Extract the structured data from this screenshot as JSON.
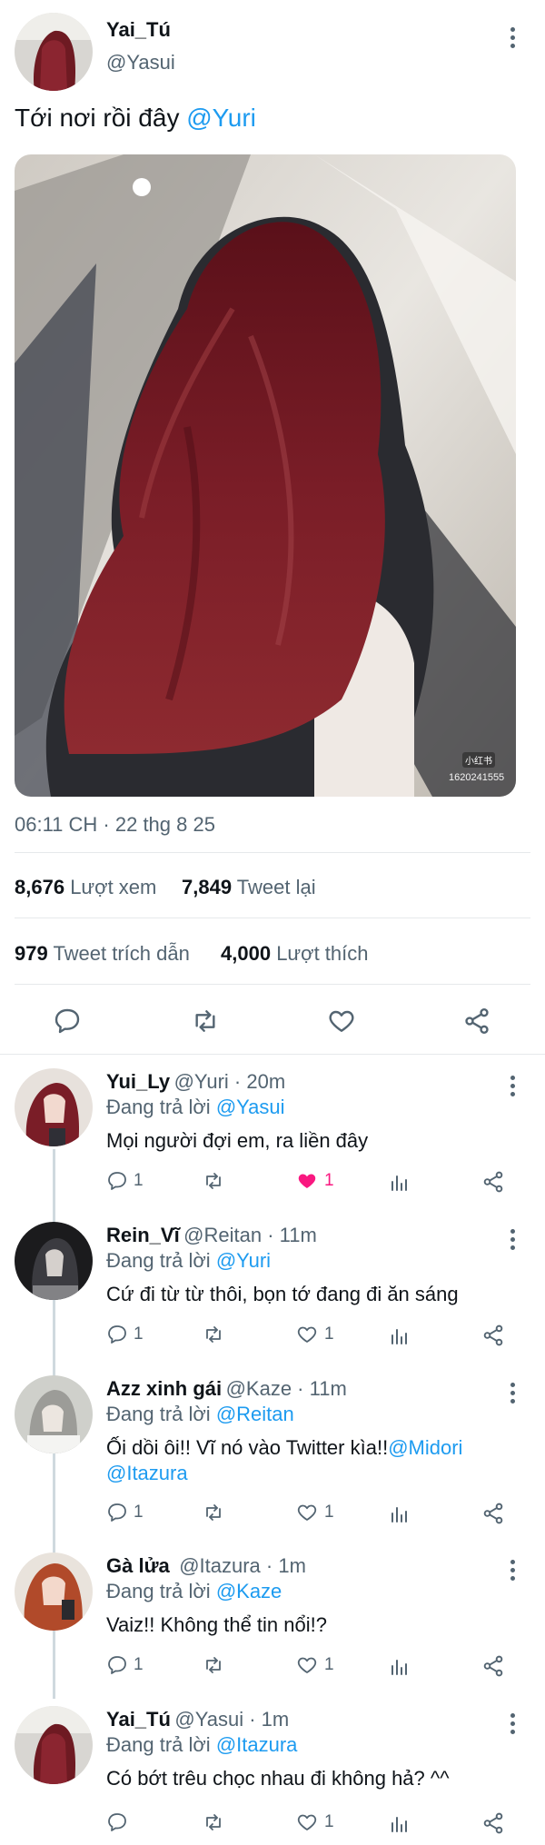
{
  "tweet": {
    "author_name": "Yai_Tú",
    "author_handle": "@Yasui",
    "text": "Tới nơi rồi đây ",
    "mention": "@Yuri",
    "watermark_logo": "小红书",
    "watermark_id": "1620241555",
    "timestamp": "06:11 CH · 22 thg 8 25",
    "views_count": "8,676",
    "views_label": "Lượt xem",
    "retweets_count": "7,849",
    "retweets_label": "Tweet lại",
    "quotes_count": "979",
    "quotes_label": "Tweet trích dẫn",
    "likes_count": "4,000",
    "likes_label": "Lượt thích"
  },
  "replies": [
    {
      "name": "Yui_Ly",
      "meta": "@Yuri · 20m",
      "replying_prefix": "Đang trả lời ",
      "replying_to": "@Yasui",
      "text": "Mọi người đợi em, ra liền đây",
      "text_link": "",
      "text_line2": "",
      "reply_count": "1",
      "like_count": "1",
      "liked": true
    },
    {
      "name": "Rein_Vĩ",
      "meta": "@Reitan · 11m",
      "replying_prefix": "Đang trả lời ",
      "replying_to": "@Yuri",
      "text": "Cứ đi từ từ thôi, bọn tớ đang đi ăn sáng",
      "text_link": "",
      "text_line2": "",
      "reply_count": "1",
      "like_count": "1",
      "liked": false
    },
    {
      "name": "Azz xinh gái",
      "meta": "@Kaze · 11m",
      "replying_prefix": "Đang trả lời ",
      "replying_to": "@Reitan",
      "text": "Ối dồi ôi!! Vĩ nó vào Twitter kìa!!",
      "text_link": "@Midori",
      "text_line2": "@Itazura",
      "reply_count": "1",
      "like_count": "1",
      "liked": false
    },
    {
      "name": "Gà lửa",
      "meta": "@Itazura · 1m",
      "replying_prefix": "Đang trả lời ",
      "replying_to": "@Kaze",
      "text": "Vaiz!! Không thể tin nổi!?",
      "text_link": "",
      "text_line2": "",
      "reply_count": "1",
      "like_count": "1",
      "liked": false
    },
    {
      "name": "Yai_Tú",
      "meta": "@Yasui · 1m",
      "replying_prefix": "Đang trả lời ",
      "replying_to": "@Itazura",
      "text": "Có bớt trêu chọc nhau đi không hả? ^^",
      "text_link": "",
      "text_line2": "",
      "reply_count": "",
      "like_count": "1",
      "liked": false
    }
  ],
  "colors": {
    "link": "#1d9bf0",
    "muted": "#536471",
    "like_red": "#f91880",
    "hair": "#6e1a22"
  }
}
